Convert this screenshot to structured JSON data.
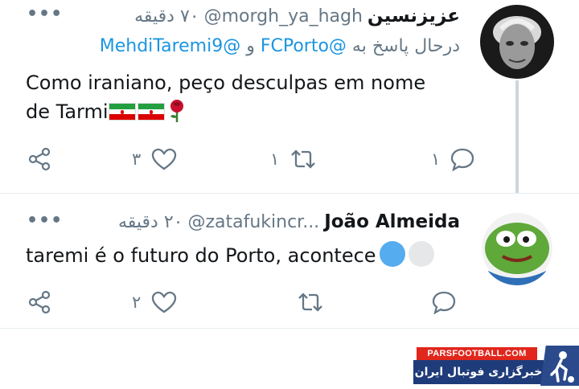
{
  "tweets": [
    {
      "display_name": "عزیزنسین",
      "handle": "@morgh_ya_hagh",
      "time": "۷۰ دقیقه",
      "reply_prefix": "درحال پاسخ به",
      "reply_mention_1": "@FCPorto",
      "reply_and": "و",
      "reply_mention_2": "@MehdiTaremi9",
      "text_line_1": "Como iraniano, peço desculpas em nome",
      "text_line_2": "de Tarmi",
      "emojis": [
        "iran-flag",
        "iran-flag",
        "rose"
      ],
      "reply_count": "۱",
      "retweet_count": "۱",
      "like_count": "۳",
      "more_label": "•••"
    },
    {
      "display_name": "João Almeida",
      "handle": "@zatafukincr...",
      "time": "۲۰ دقیقه",
      "text": "taremi é o futuro do Porto, acontece",
      "emojis": [
        "blue-circle",
        "white-circle"
      ],
      "reply_count": "",
      "retweet_count": "",
      "like_count": "۲",
      "more_label": "•••"
    }
  ],
  "watermark": {
    "site": "PARSFOOTBALL.COM",
    "tagline": "خبرگزاری فوتبال ایران"
  },
  "colors": {
    "text": "#14171a",
    "muted": "#657786",
    "link": "#1b95e0",
    "divider": "#e6ecf0",
    "banner_red": "#e1261c",
    "banner_blue": "#1f3c7a"
  }
}
